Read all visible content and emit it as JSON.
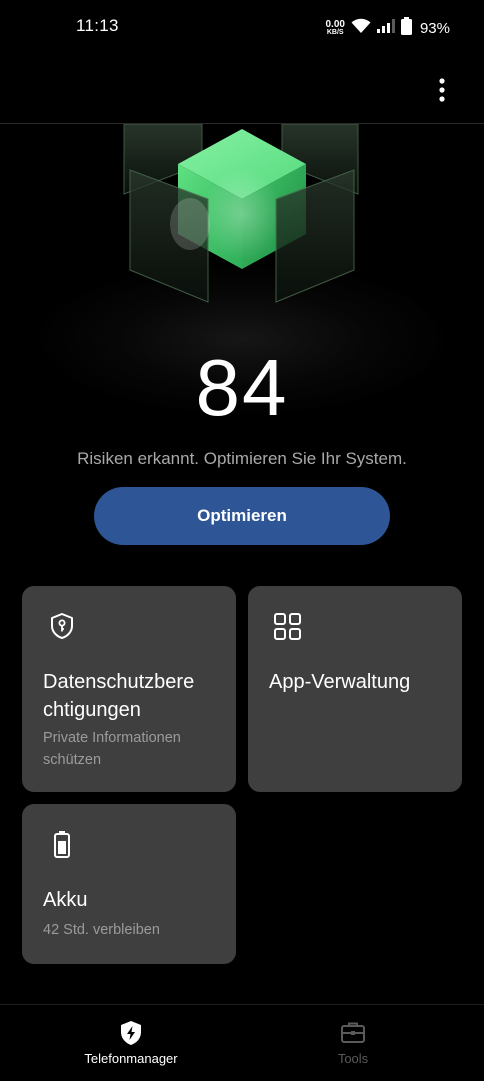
{
  "status_bar": {
    "time": "11:13",
    "net_speed_value": "0.00",
    "net_speed_unit": "KB/S",
    "battery_percent": "93%",
    "icons": [
      "wifi-icon",
      "signal-icon",
      "battery-icon"
    ]
  },
  "app_bar": {
    "more_icon": "more-vert-icon"
  },
  "hero": {
    "score": "84",
    "message": "Risiken erkannt. Optimieren Sie Ihr System.",
    "button_label": "Optimieren",
    "accent_color": "#2e5596",
    "cube_color": "#3fd36f"
  },
  "cards": [
    {
      "icon": "privacy-shield-icon",
      "title": "Datenschutzbere\nchtigungen",
      "title_line1": "Datenschutzbere",
      "title_line2": "chtigungen",
      "desc_line1": "Private Informationen",
      "desc_line2": "schützen"
    },
    {
      "icon": "apps-grid-icon",
      "title": "App-Verwaltung"
    },
    {
      "icon": "battery-icon",
      "title": "Akku",
      "desc": "42 Std. verbleiben"
    }
  ],
  "bottom_nav": {
    "items": [
      {
        "label": "Telefonmanager",
        "icon": "shield-bolt-icon",
        "active": true
      },
      {
        "label": "Tools",
        "icon": "toolbox-icon",
        "active": false
      }
    ]
  },
  "colors": {
    "background": "#000000",
    "card": "#3f3f3f",
    "nav_active": "#ffffff",
    "nav_inactive": "#5a5a5a"
  }
}
